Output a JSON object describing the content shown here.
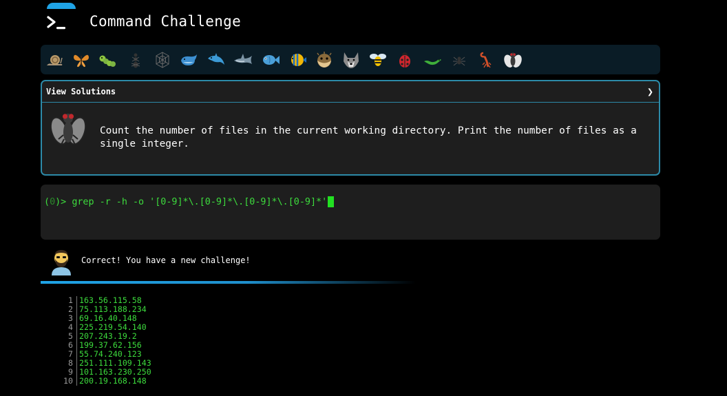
{
  "header": {
    "title": "Command Challenge"
  },
  "creatures": [
    {
      "name": "snail-icon"
    },
    {
      "name": "butterfly-icon"
    },
    {
      "name": "caterpillar-icon"
    },
    {
      "name": "ant-icon"
    },
    {
      "name": "spider-web-icon"
    },
    {
      "name": "whale-icon"
    },
    {
      "name": "dolphin-icon"
    },
    {
      "name": "shark-icon"
    },
    {
      "name": "fish-icon"
    },
    {
      "name": "tropical-fish-icon"
    },
    {
      "name": "blowfish-icon"
    },
    {
      "name": "wolf-icon"
    },
    {
      "name": "bee-icon"
    },
    {
      "name": "ladybug-icon"
    },
    {
      "name": "lizard-icon"
    },
    {
      "name": "spider-icon"
    },
    {
      "name": "scorpion-icon"
    },
    {
      "name": "fly-icon"
    }
  ],
  "panel": {
    "label": "View Solutions",
    "chevron": "❯",
    "challenge": "Count the number of files in the current working directory. Print the number of files as a single integer."
  },
  "terminal": {
    "prompt_open": "(",
    "prompt_count": "0",
    "prompt_close": ")> ",
    "command": "grep -r -h -o '[0-9]*\\.[0-9]*\\.[0-9]*\\.[0-9]*'"
  },
  "response": {
    "message": "Correct! You have a new challenge!"
  },
  "output": {
    "lines": [
      {
        "n": "1",
        "text": "163.56.115.58"
      },
      {
        "n": "2",
        "text": "75.113.188.234"
      },
      {
        "n": "3",
        "text": "69.16.40.148"
      },
      {
        "n": "4",
        "text": "225.219.54.140"
      },
      {
        "n": "5",
        "text": "207.243.19.2"
      },
      {
        "n": "6",
        "text": "199.37.62.156"
      },
      {
        "n": "7",
        "text": "55.74.240.123"
      },
      {
        "n": "8",
        "text": "251.111.109.143"
      },
      {
        "n": "9",
        "text": "101.163.230.250"
      },
      {
        "n": "10",
        "text": "200.19.168.148"
      }
    ]
  },
  "colors": {
    "accent": "#1fa3e6",
    "panel_border": "#2c8aa8",
    "terminal_green": "#3ddc3d",
    "background": "#000000"
  }
}
